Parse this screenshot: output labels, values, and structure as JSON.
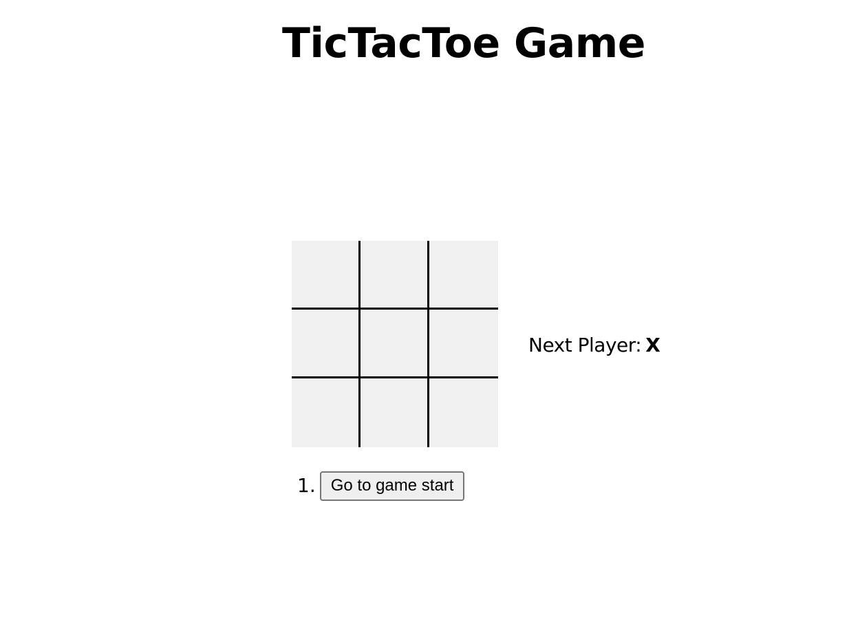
{
  "title": "TicTacToe Game",
  "board": {
    "cells": [
      "",
      "",
      "",
      "",
      "",
      "",
      "",
      "",
      ""
    ]
  },
  "status": {
    "label": "Next Player:",
    "player": "X"
  },
  "moves": [
    {
      "number": "1.",
      "label": "Go to game start"
    }
  ]
}
